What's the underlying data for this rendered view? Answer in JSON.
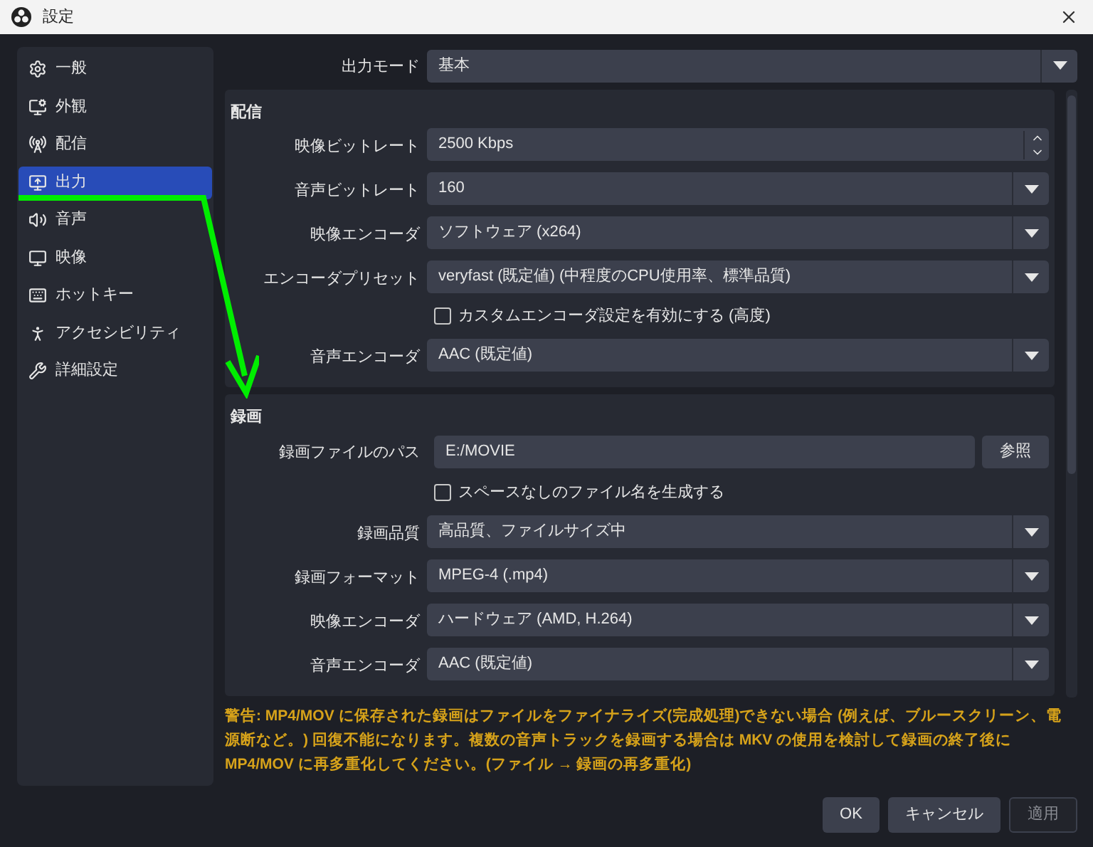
{
  "window": {
    "title": "設定"
  },
  "sidebar": {
    "items": [
      {
        "label": "一般",
        "selected": false
      },
      {
        "label": "外観",
        "selected": false
      },
      {
        "label": "配信",
        "selected": false
      },
      {
        "label": "出力",
        "selected": true
      },
      {
        "label": "音声",
        "selected": false
      },
      {
        "label": "映像",
        "selected": false
      },
      {
        "label": "ホットキー",
        "selected": false
      },
      {
        "label": "アクセシビリティ",
        "selected": false
      },
      {
        "label": "詳細設定",
        "selected": false
      }
    ]
  },
  "output_mode": {
    "label": "出力モード",
    "value": "基本"
  },
  "sections": [
    {
      "title": "配信",
      "rows": [
        {
          "kind": "spin",
          "label": "映像ビットレート",
          "value": "2500 Kbps"
        },
        {
          "kind": "select",
          "label": "音声ビットレート",
          "value": "160"
        },
        {
          "kind": "select",
          "label": "映像エンコーダ",
          "value": "ソフトウェア (x264)"
        },
        {
          "kind": "select",
          "label": "エンコーダプリセット",
          "value": "veryfast (既定値) (中程度のCPU使用率、標準品質)"
        },
        {
          "kind": "checkbox",
          "label": "カスタムエンコーダ設定を有効にする (高度)",
          "checked": false
        },
        {
          "kind": "select",
          "label": "音声エンコーダ",
          "value": "AAC (既定値)"
        }
      ]
    },
    {
      "title": "録画",
      "rows": [
        {
          "kind": "path",
          "label": "録画ファイルのパス",
          "value": "E:/MOVIE",
          "button": "参照"
        },
        {
          "kind": "checkbox",
          "label": "スペースなしのファイル名を生成する",
          "checked": false
        },
        {
          "kind": "select",
          "label": "録画品質",
          "value": "高品質、ファイルサイズ中"
        },
        {
          "kind": "select",
          "label": "録画フォーマット",
          "value": "MPEG-4 (.mp4)"
        },
        {
          "kind": "select",
          "label": "映像エンコーダ",
          "value": "ハードウェア (AMD, H.264)"
        },
        {
          "kind": "select",
          "label": "音声エンコーダ",
          "value": "AAC (既定値)"
        }
      ]
    }
  ],
  "warning": "警告: MP4/MOV に保存された録画はファイルをファイナライズ(完成処理)できない場合 (例えば、ブルースクリーン、電源断など。) 回復不能になります。複数の音声トラックを録画する場合は MKV の使用を検討して録画の終了後に MP4/MOV に再多重化してください。(ファイル → 録画の再多重化)",
  "buttons": [
    {
      "label": "OK",
      "disabled": false
    },
    {
      "label": "キャンセル",
      "disabled": false
    },
    {
      "label": "適用",
      "disabled": true
    }
  ]
}
